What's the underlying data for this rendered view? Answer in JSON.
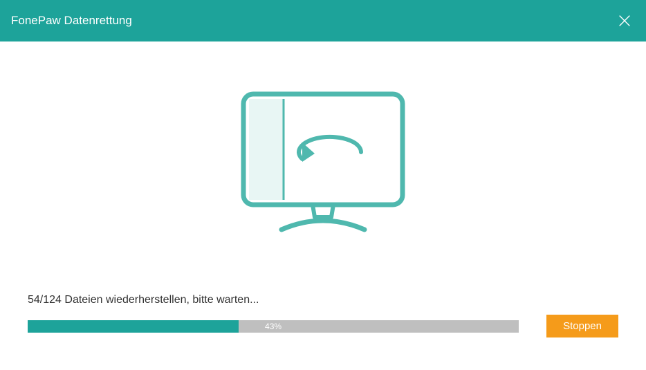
{
  "header": {
    "title": "FonePaw Datenrettung"
  },
  "main": {
    "status_text": "54/124 Dateien wiederherstellen, bitte warten...",
    "progress_percent": "43",
    "progress_label": "43%",
    "stop_label": "Stoppen"
  },
  "colors": {
    "primary": "#1da39a",
    "accent": "#f59b1a"
  }
}
